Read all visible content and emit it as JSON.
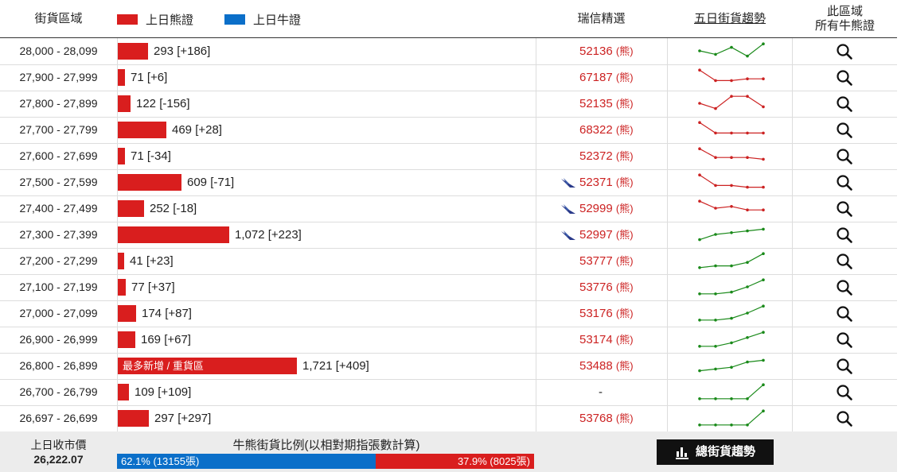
{
  "header": {
    "range": "街貨區域",
    "bear_legend": "上日熊證",
    "bull_legend": "上日牛證",
    "selection": "瑞信精選",
    "trend": "五日街貨趨勢",
    "all_line1": "此區域",
    "all_line2": "所有牛熊證"
  },
  "colors": {
    "bear": "#d91e1e",
    "bull": "#0b6fc9",
    "trend_down": "#cc2222",
    "trend_up": "#1a8a1a"
  },
  "bracket": "(熊)",
  "rows": [
    {
      "range": "28,000 - 28,099",
      "qty": 293,
      "bar_text": "293 [+186]",
      "bar_label": "",
      "code": "52136",
      "br": "(熊)",
      "icon": false,
      "trend": "up",
      "spark": [
        5,
        3,
        7,
        2,
        9
      ]
    },
    {
      "range": "27,900 - 27,999",
      "qty": 71,
      "bar_text": "71 [+6]",
      "bar_label": "",
      "code": "67187",
      "br": "(熊)",
      "icon": false,
      "trend": "down",
      "spark": [
        9,
        3,
        3,
        4,
        4
      ]
    },
    {
      "range": "27,800 - 27,899",
      "qty": 122,
      "bar_text": "122 [-156]",
      "bar_label": "",
      "code": "52135",
      "br": "(熊)",
      "icon": false,
      "trend": "down",
      "spark": [
        5,
        2,
        9,
        9,
        3
      ]
    },
    {
      "range": "27,700 - 27,799",
      "qty": 469,
      "bar_text": "469 [+28]",
      "bar_label": "",
      "code": "68322",
      "br": "(熊)",
      "icon": false,
      "trend": "down",
      "spark": [
        9,
        3,
        3,
        3,
        3
      ]
    },
    {
      "range": "27,600 - 27,699",
      "qty": 71,
      "bar_text": "71 [-34]",
      "bar_label": "",
      "code": "52372",
      "br": "(熊)",
      "icon": false,
      "trend": "down",
      "spark": [
        9,
        4,
        4,
        4,
        3
      ]
    },
    {
      "range": "27,500 - 27,599",
      "qty": 609,
      "bar_text": "609 [-71]",
      "bar_label": "",
      "code": "52371",
      "br": "(熊)",
      "icon": true,
      "trend": "down",
      "spark": [
        9,
        3,
        3,
        2,
        2
      ]
    },
    {
      "range": "27,400 - 27,499",
      "qty": 252,
      "bar_text": "252 [-18]",
      "bar_label": "",
      "code": "52999",
      "br": "(熊)",
      "icon": true,
      "trend": "down",
      "spark": [
        9,
        5,
        6,
        4,
        4
      ]
    },
    {
      "range": "27,300 - 27,399",
      "qty": 1072,
      "bar_text": "1,072 [+223]",
      "bar_label": "",
      "code": "52997",
      "br": "(熊)",
      "icon": true,
      "trend": "up",
      "spark": [
        2,
        5,
        6,
        7,
        8
      ]
    },
    {
      "range": "27,200 - 27,299",
      "qty": 41,
      "bar_text": "41 [+23]",
      "bar_label": "",
      "code": "53777",
      "br": "(熊)",
      "icon": false,
      "trend": "up",
      "spark": [
        1,
        2,
        2,
        4,
        9
      ]
    },
    {
      "range": "27,100 - 27,199",
      "qty": 77,
      "bar_text": "77 [+37]",
      "bar_label": "",
      "code": "53776",
      "br": "(熊)",
      "icon": false,
      "trend": "up",
      "spark": [
        1,
        1,
        2,
        5,
        9
      ]
    },
    {
      "range": "27,000 - 27,099",
      "qty": 174,
      "bar_text": "174 [+87]",
      "bar_label": "",
      "code": "53176",
      "br": "(熊)",
      "icon": false,
      "trend": "up",
      "spark": [
        1,
        1,
        2,
        5,
        9
      ]
    },
    {
      "range": "26,900 - 26,999",
      "qty": 169,
      "bar_text": "169 [+67]",
      "bar_label": "",
      "code": "53174",
      "br": "(熊)",
      "icon": false,
      "trend": "up",
      "spark": [
        1,
        1,
        3,
        6,
        9
      ]
    },
    {
      "range": "26,800 - 26,899",
      "qty": 1721,
      "bar_text": "1,721 [+409]",
      "bar_label": "最多新增 / 重貨區",
      "code": "53488",
      "br": "(熊)",
      "icon": false,
      "trend": "up",
      "spark": [
        2,
        3,
        4,
        7,
        8
      ]
    },
    {
      "range": "26,700 - 26,799",
      "qty": 109,
      "bar_text": "109 [+109]",
      "bar_label": "",
      "code": "-",
      "br": "",
      "icon": false,
      "trend": "up",
      "spark": [
        1,
        1,
        1,
        1,
        9
      ]
    },
    {
      "range": "26,697 - 26,699",
      "qty": 297,
      "bar_text": "297 [+297]",
      "bar_label": "",
      "code": "53768",
      "br": "(熊)",
      "icon": false,
      "trend": "up",
      "spark": [
        1,
        1,
        1,
        1,
        9
      ]
    }
  ],
  "footer": {
    "close_label": "上日收市價",
    "close_value": "26,222.07",
    "ratio_title": "牛熊街貨比例(以相對期指張數計算)",
    "bull_pct": 62.1,
    "bull_text": "62.1% (13155張)",
    "bear_text": "37.9% (8025張)",
    "button": "總街貨趨勢"
  }
}
